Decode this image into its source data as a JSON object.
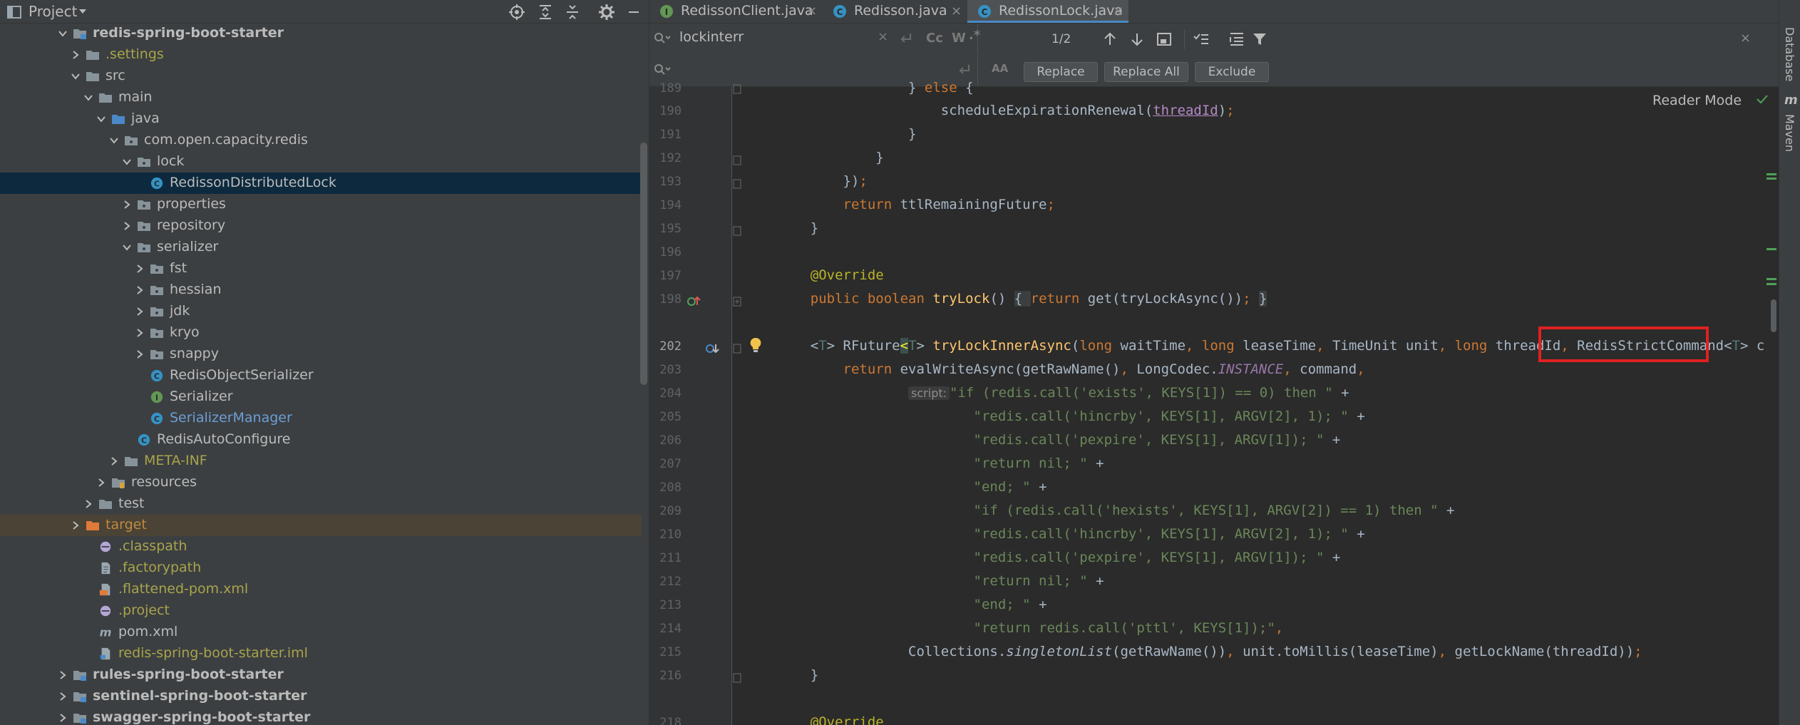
{
  "project_panel": {
    "title": "Project",
    "tree": [
      {
        "label": "redis-spring-boot-starter",
        "depth": 2,
        "arrow": "down",
        "icon": "module-folder-icon",
        "style": "bold"
      },
      {
        "label": ".settings",
        "depth": 3,
        "arrow": "right",
        "icon": "folder-icon",
        "style": "olive"
      },
      {
        "label": "src",
        "depth": 3,
        "arrow": "down",
        "icon": "folder-icon",
        "style": ""
      },
      {
        "label": "main",
        "depth": 4,
        "arrow": "down",
        "icon": "folder-icon",
        "style": ""
      },
      {
        "label": "java",
        "depth": 5,
        "arrow": "down",
        "icon": "source-folder-icon",
        "style": ""
      },
      {
        "label": "com.open.capacity.redis",
        "depth": 6,
        "arrow": "down",
        "icon": "package-icon",
        "style": ""
      },
      {
        "label": "lock",
        "depth": 7,
        "arrow": "down",
        "icon": "package-icon",
        "style": ""
      },
      {
        "label": "RedissonDistributedLock",
        "depth": 8,
        "arrow": "",
        "icon": "class-icon",
        "style": "",
        "selected": true
      },
      {
        "label": "properties",
        "depth": 7,
        "arrow": "right",
        "icon": "package-icon",
        "style": ""
      },
      {
        "label": "repository",
        "depth": 7,
        "arrow": "right",
        "icon": "package-icon",
        "style": ""
      },
      {
        "label": "serializer",
        "depth": 7,
        "arrow": "down",
        "icon": "package-icon",
        "style": ""
      },
      {
        "label": "fst",
        "depth": 8,
        "arrow": "right",
        "icon": "package-icon",
        "style": ""
      },
      {
        "label": "hessian",
        "depth": 8,
        "arrow": "right",
        "icon": "package-icon",
        "style": ""
      },
      {
        "label": "jdk",
        "depth": 8,
        "arrow": "right",
        "icon": "package-icon",
        "style": ""
      },
      {
        "label": "kryo",
        "depth": 8,
        "arrow": "right",
        "icon": "package-icon",
        "style": ""
      },
      {
        "label": "snappy",
        "depth": 8,
        "arrow": "right",
        "icon": "package-icon",
        "style": ""
      },
      {
        "label": "RedisObjectSerializer",
        "depth": 8,
        "arrow": "",
        "icon": "class-icon",
        "style": ""
      },
      {
        "label": "Serializer",
        "depth": 8,
        "arrow": "",
        "icon": "interface-icon",
        "style": ""
      },
      {
        "label": "SerializerManager",
        "depth": 8,
        "arrow": "",
        "icon": "class-icon",
        "style": "blue"
      },
      {
        "label": "RedisAutoConfigure",
        "depth": 7,
        "arrow": "",
        "icon": "class-icon",
        "style": ""
      },
      {
        "label": "META-INF",
        "depth": 6,
        "arrow": "right",
        "icon": "folder-icon",
        "style": "olive"
      },
      {
        "label": "resources",
        "depth": 5,
        "arrow": "right",
        "icon": "resources-folder-icon",
        "style": ""
      },
      {
        "label": "test",
        "depth": 4,
        "arrow": "right",
        "icon": "folder-icon",
        "style": ""
      },
      {
        "label": "target",
        "depth": 3,
        "arrow": "right",
        "icon": "excluded-folder-icon",
        "style": "orange",
        "excluded": true
      },
      {
        "label": ".classpath",
        "depth": 4,
        "arrow": "",
        "icon": "config-file-icon",
        "style": "olive"
      },
      {
        "label": ".factorypath",
        "depth": 4,
        "arrow": "",
        "icon": "text-file-icon",
        "style": "olive"
      },
      {
        "label": ".flattened-pom.xml",
        "depth": 4,
        "arrow": "",
        "icon": "xml-file-icon",
        "style": "olive"
      },
      {
        "label": ".project",
        "depth": 4,
        "arrow": "",
        "icon": "config-file-icon",
        "style": "olive"
      },
      {
        "label": "pom.xml",
        "depth": 4,
        "arrow": "",
        "icon": "maven-file-icon",
        "style": ""
      },
      {
        "label": "redis-spring-boot-starter.iml",
        "depth": 4,
        "arrow": "",
        "icon": "iml-file-icon",
        "style": "olive"
      },
      {
        "label": "rules-spring-boot-starter",
        "depth": 2,
        "arrow": "right",
        "icon": "module-folder-icon",
        "style": "bold"
      },
      {
        "label": "sentinel-spring-boot-starter",
        "depth": 2,
        "arrow": "right",
        "icon": "module-folder-icon",
        "style": "bold"
      },
      {
        "label": "swagger-spring-boot-starter",
        "depth": 2,
        "arrow": "right",
        "icon": "module-folder-icon",
        "style": "bold"
      }
    ]
  },
  "tabs": [
    {
      "label": "RedissonClient.java",
      "icon": "interface-icon",
      "active": false
    },
    {
      "label": "Redisson.java",
      "icon": "class-icon",
      "active": false
    },
    {
      "label": "RedissonLock.java",
      "icon": "class-icon",
      "active": true
    }
  ],
  "find": {
    "search_value": "lockinterr",
    "replace_value": "",
    "match_count": "1/2",
    "options": [
      "Cc",
      "W",
      ".*"
    ],
    "replace_button": "Replace",
    "replace_all_button": "Replace All",
    "exclude_button": "Exclude"
  },
  "editor": {
    "reader_mode": "Reader Mode",
    "highlighted_method": "tryLockInnerAsync",
    "inlay_hint": "script:",
    "line_numbers": [
      "189",
      "190",
      "191",
      "192",
      "193",
      "194",
      "195",
      "196",
      "197",
      "198",
      "202",
      "203",
      "204",
      "205",
      "206",
      "207",
      "208",
      "209",
      "210",
      "211",
      "212",
      "213",
      "214",
      "215",
      "216",
      "218"
    ]
  },
  "right_strip": {
    "database": "Database",
    "maven": "Maven"
  }
}
